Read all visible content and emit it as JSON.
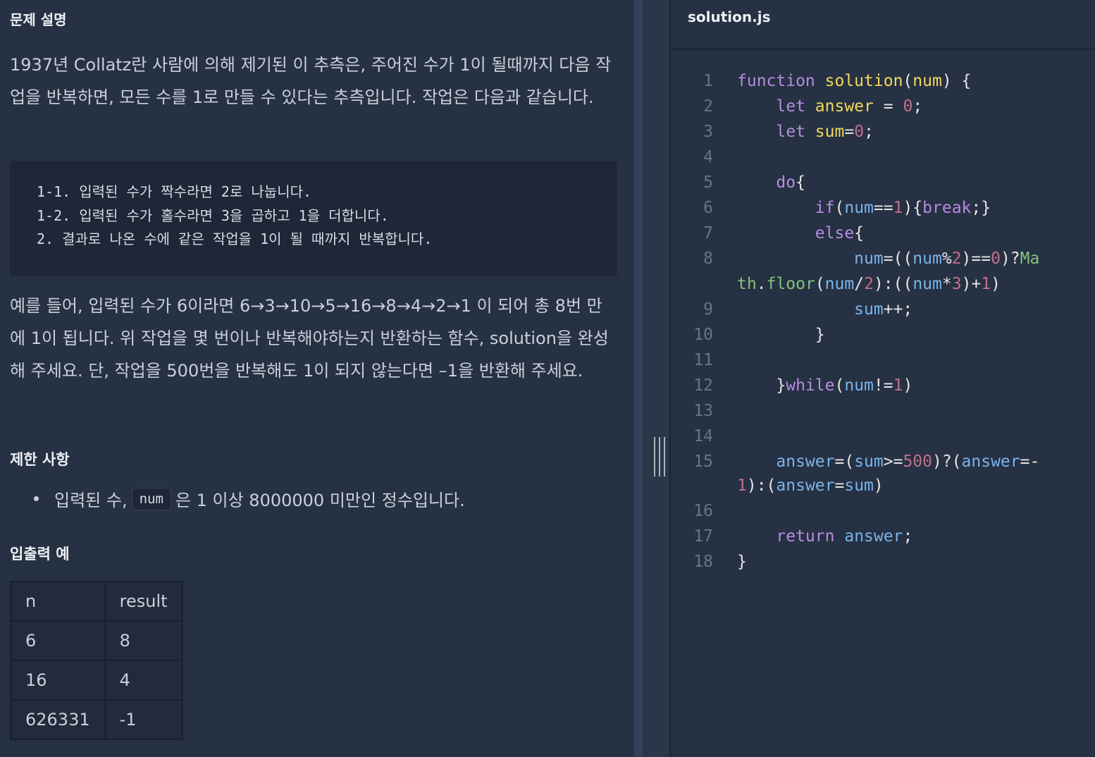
{
  "problem": {
    "title": "문제 설명",
    "para1": "1937년 Collatz란 사람에 의해 제기된 이 추측은, 주어진 수가 1이 될때까지 다음 작업을 반복하면, 모든 수를 1로 만들 수 있다는 추측입니다. 작업은 다음과 같습니다.",
    "steps": [
      "1-1. 입력된 수가 짝수라면 2로 나눕니다.",
      "1-2. 입력된 수가 홀수라면 3을 곱하고 1을 더합니다.",
      "2. 결과로 나온 수에 같은 작업을 1이 될 때까지 반복합니다."
    ],
    "para2": "예를 들어, 입력된 수가 6이라면 6→3→10→5→16→8→4→2→1 이 되어 총 8번 만에 1이 됩니다. 위 작업을 몇 번이나 반복해야하는지 반환하는 함수, solution을 완성해 주세요. 단, 작업을 500번을 반복해도 1이 되지 않는다면 –1을 반환해 주세요."
  },
  "constraints": {
    "title": "제한 사항",
    "item_prefix": "입력된 수,",
    "item_code": "num",
    "item_suffix": "은 1 이상 8000000 미만인 정수입니다."
  },
  "examples": {
    "title": "입출력 예",
    "headers": [
      "n",
      "result"
    ],
    "rows": [
      [
        "6",
        "8"
      ],
      [
        "16",
        "4"
      ],
      [
        "626331",
        "-1"
      ]
    ]
  },
  "editor": {
    "filename": "solution.js",
    "line_numbers": [
      "1",
      "2",
      "3",
      "4",
      "5",
      "6",
      "7",
      "8",
      "9",
      "10",
      "11",
      "12",
      "13",
      "14",
      "15",
      "16",
      "17",
      "18"
    ]
  },
  "colors": {
    "background": "#263143",
    "code_box": "#1e2637",
    "keyword": "#b78ce0",
    "function": "#f2d95a",
    "variable": "#79b4ea",
    "number": "#c0708a",
    "property": "#83c27a"
  }
}
